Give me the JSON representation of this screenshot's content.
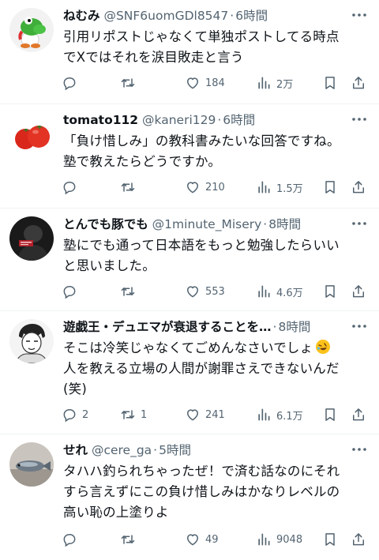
{
  "posts": [
    {
      "name": "ねむみ",
      "handle": "@SNF6uomGDl8547",
      "sep": "·",
      "time": "6時間",
      "lines": [
        "引用リポストじゃなくて単独ポストしてる時点",
        "でXではそれを涙目敗走と言う"
      ],
      "stats": {
        "reply": "",
        "repost": "",
        "like": "184",
        "views": "2万"
      },
      "avatar": "yoshi-avatar"
    },
    {
      "name": "tomato112",
      "handle": "@kaneri129",
      "sep": "·",
      "time": "6時間",
      "lines": [
        "「負け惜しみ」の教科書みたいな回答ですね。",
        "塾で教えたらどうですか。"
      ],
      "stats": {
        "reply": "",
        "repost": "",
        "like": "210",
        "views": "1.5万"
      },
      "avatar": "tomato-avatar"
    },
    {
      "name": "とんでも豚でも",
      "handle": "@1minute_Misery",
      "sep": "·",
      "time": "8時間",
      "lines": [
        "塾にでも通って日本語をもっと勉強したらいい",
        "と思いました。"
      ],
      "stats": {
        "reply": "",
        "repost": "",
        "like": "553",
        "views": "4.6万"
      },
      "avatar": "dark-figure-avatar"
    },
    {
      "name": "遊戯王・デュエマが衰退することを…",
      "handle": "",
      "sep": "·",
      "time": "8時間",
      "lines": [
        "そこは冷笑じゃなくてごめんなさいでしょ",
        "人を教える立場の人間が謝罪さえできないんだ",
        "(笑)"
      ],
      "stats": {
        "reply": "2",
        "repost": "1",
        "like": "241",
        "views": "6.1万"
      },
      "avatar": "manga-avatar"
    },
    {
      "name": "せれ",
      "handle": "@cere_ga",
      "sep": "·",
      "time": "5時間",
      "lines": [
        "タハハ釣られちゃったぜ！で済む話なのにそれ",
        "すら言えずにこの負け惜しみはかなりレベルの",
        "高い恥の上塗りよ"
      ],
      "stats": {
        "reply": "",
        "repost": "",
        "like": "49",
        "views": "9048"
      },
      "avatar": "fish-avatar"
    }
  ],
  "colors": {
    "text": "#0f1419",
    "muted": "#536471",
    "divider": "#eff3f4"
  }
}
